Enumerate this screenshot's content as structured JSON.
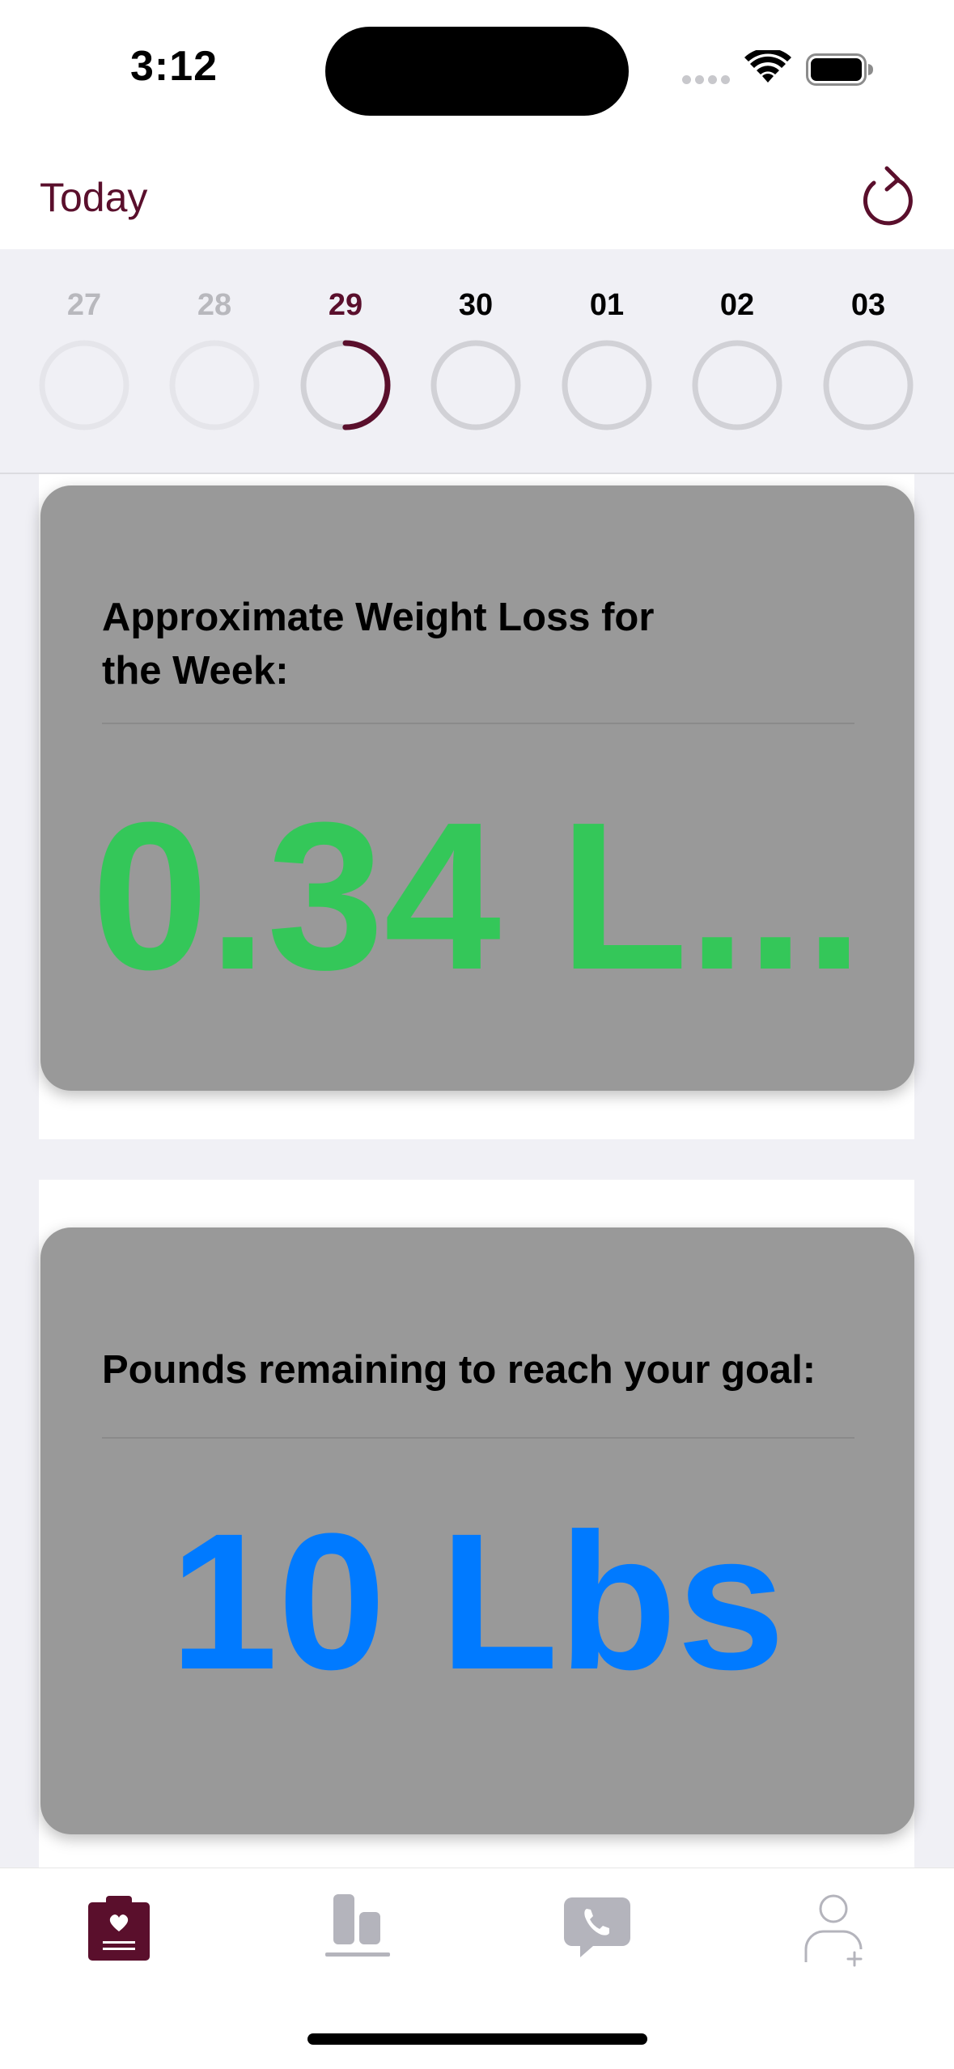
{
  "status_bar": {
    "time": "3:12"
  },
  "nav": {
    "title": "Today",
    "refresh_icon": "arrow-clockwise-icon"
  },
  "week": {
    "days": [
      {
        "label": "27",
        "state": "past",
        "progress": 0
      },
      {
        "label": "28",
        "state": "past",
        "progress": 0
      },
      {
        "label": "29",
        "state": "today",
        "progress": 0.5
      },
      {
        "label": "30",
        "state": "future",
        "progress": 0
      },
      {
        "label": "01",
        "state": "future",
        "progress": 0
      },
      {
        "label": "02",
        "state": "future",
        "progress": 0
      },
      {
        "label": "03",
        "state": "future",
        "progress": 0
      }
    ]
  },
  "cards": [
    {
      "title": "Approximate Weight Loss for the Week:",
      "value": "0.34 L...",
      "value_color": "#34c759"
    },
    {
      "title": "Pounds remaining to reach your goal:",
      "value": "10 Lbs",
      "value_color": "#007aff"
    }
  ],
  "tabs": [
    {
      "name": "tab-today",
      "icon": "clipboard-heart-icon",
      "selected": true
    },
    {
      "name": "tab-progress",
      "icon": "bar-chart-icon",
      "selected": false
    },
    {
      "name": "tab-messages",
      "icon": "phone-bubble-icon",
      "selected": false
    },
    {
      "name": "tab-profile",
      "icon": "person-add-icon",
      "selected": false
    }
  ],
  "colors": {
    "accent": "#5a0f2c",
    "ring_past": "#e5e5ea",
    "ring_future": "#d1d1d6",
    "label_past": "#b8b8bd",
    "tab_inactive": "#b4b4bc",
    "card_bg": "#999999",
    "strip_bg": "#f0f0f5"
  }
}
